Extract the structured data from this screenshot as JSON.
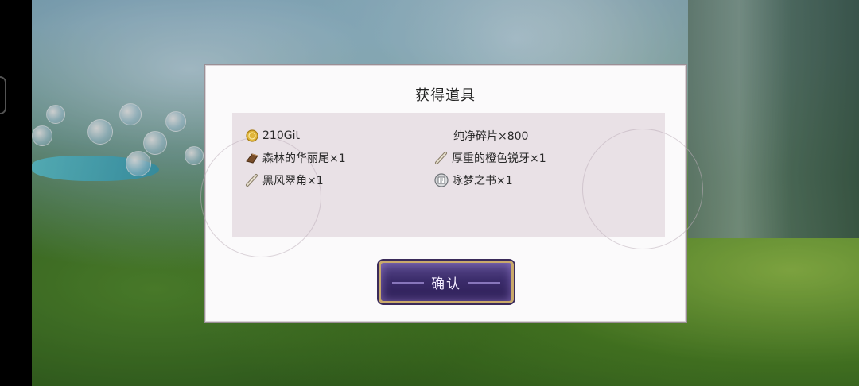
{
  "dialog": {
    "title": "获得道具",
    "confirm_label": "确认",
    "items": [
      {
        "icon": "gold-coin-icon",
        "label": "210Git"
      },
      {
        "icon": "",
        "label": "纯净碎片×800"
      },
      {
        "icon": "brown-tail-icon",
        "label": "森林的华丽尾×1"
      },
      {
        "icon": "bone-fang-icon",
        "label": "厚重的橙色锐牙×1"
      },
      {
        "icon": "bone-horn-icon",
        "label": "黑风翠角×1"
      },
      {
        "icon": "book-icon",
        "label": "咏梦之书×1"
      }
    ]
  },
  "colors": {
    "coin": "#e0b53a",
    "button_top": "#5a4a8c",
    "button_bottom": "#2d1f55",
    "button_border": "#c9a96a"
  }
}
